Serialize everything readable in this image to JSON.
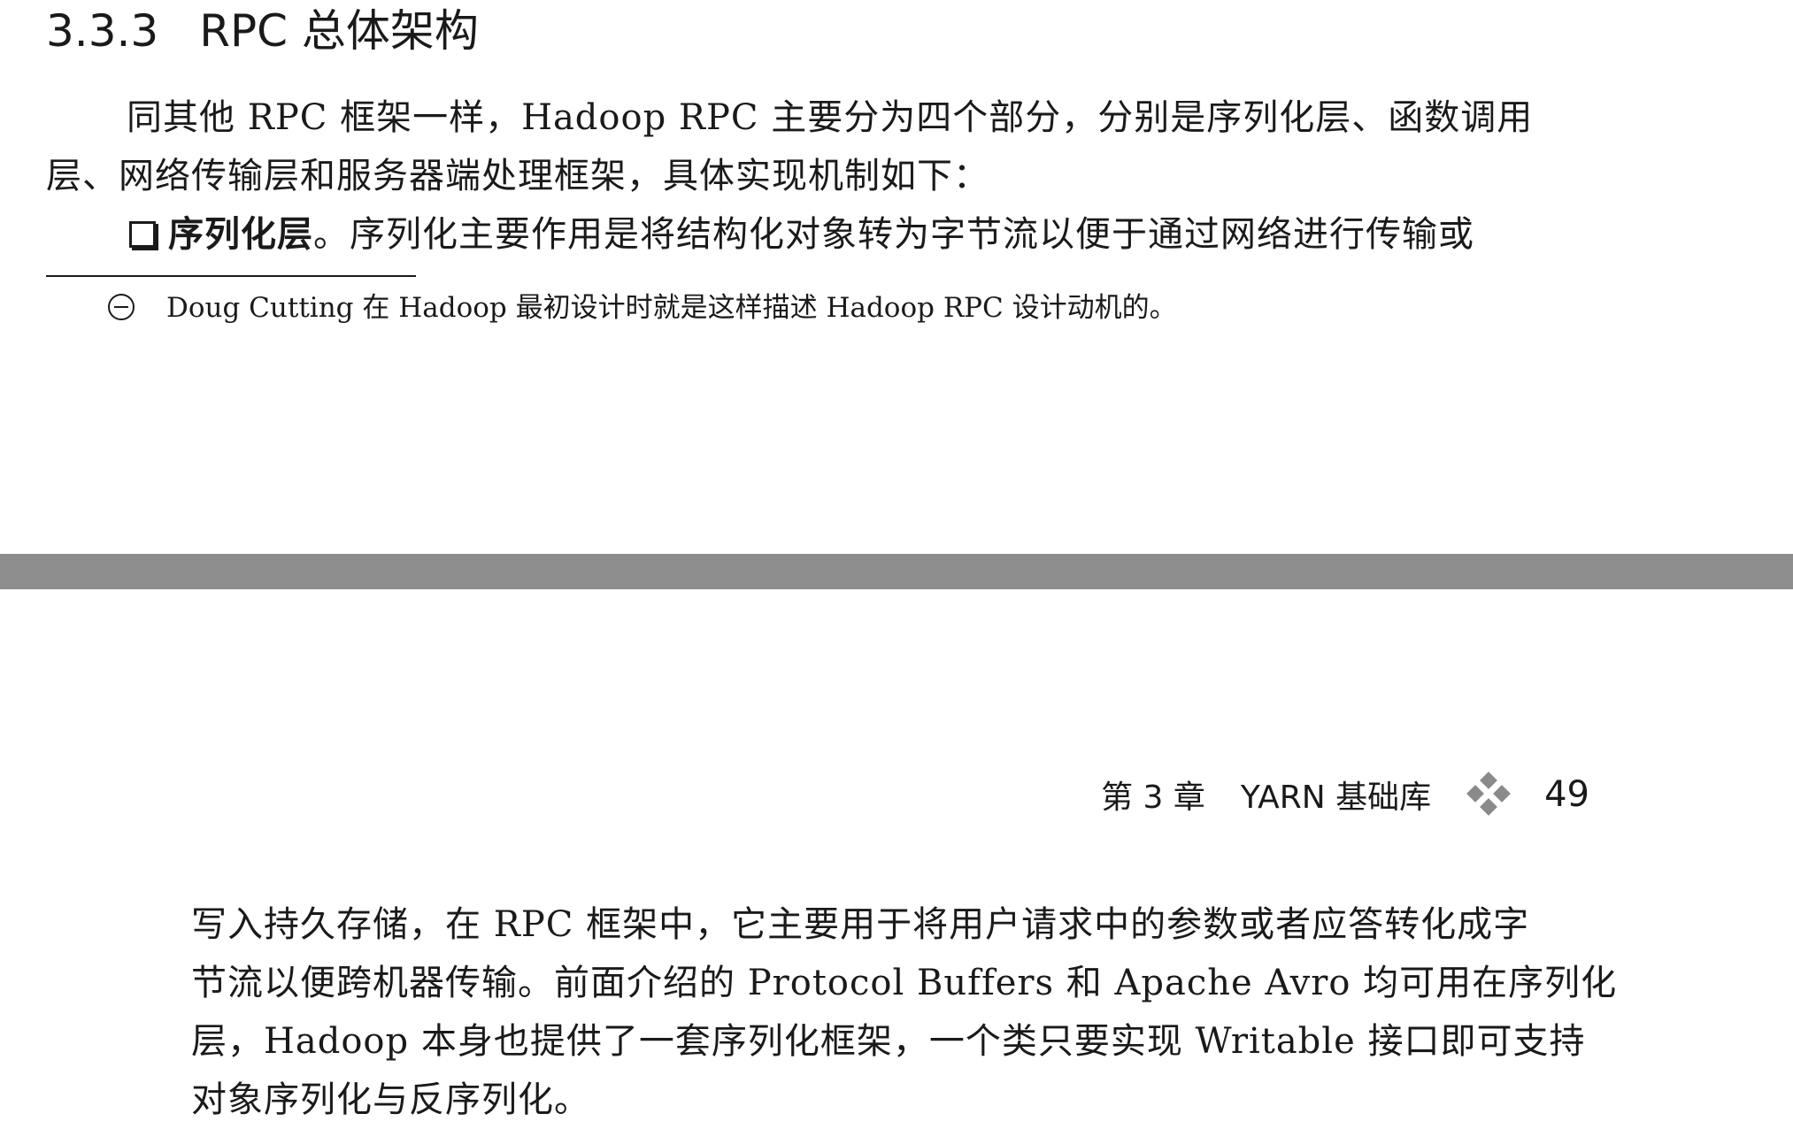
{
  "section": {
    "number": "3.3.3",
    "title": "RPC 总体架构"
  },
  "intro_paragraph": {
    "line1": "同其他 RPC 框架一样，Hadoop RPC 主要分为四个部分，分别是序列化层、函数调用",
    "line2": "层、网络传输层和服务器端处理框架，具体实现机制如下："
  },
  "bullet": {
    "term": "序列化层",
    "text": "。序列化主要作用是将结构化对象转为字节流以便于通过网络进行传输或"
  },
  "footnote": {
    "text": "Doug Cutting 在 Hadoop 最初设计时就是这样描述 Hadoop RPC 设计动机的。"
  },
  "running_header": {
    "chapter": "第 3 章",
    "title": "YARN 基础库",
    "page_number": "49"
  },
  "continuation_paragraph": {
    "line1": "写入持久存储，在 RPC 框架中，它主要用于将用户请求中的参数或者应答转化成字",
    "line2": "节流以便跨机器传输。前面介绍的 Protocol Buffers 和 Apache Avro 均可用在序列化",
    "line3": "层，Hadoop 本身也提供了一套序列化框架，一个类只要实现 Writable 接口即可支持",
    "line4": "对象序列化与反序列化。"
  }
}
